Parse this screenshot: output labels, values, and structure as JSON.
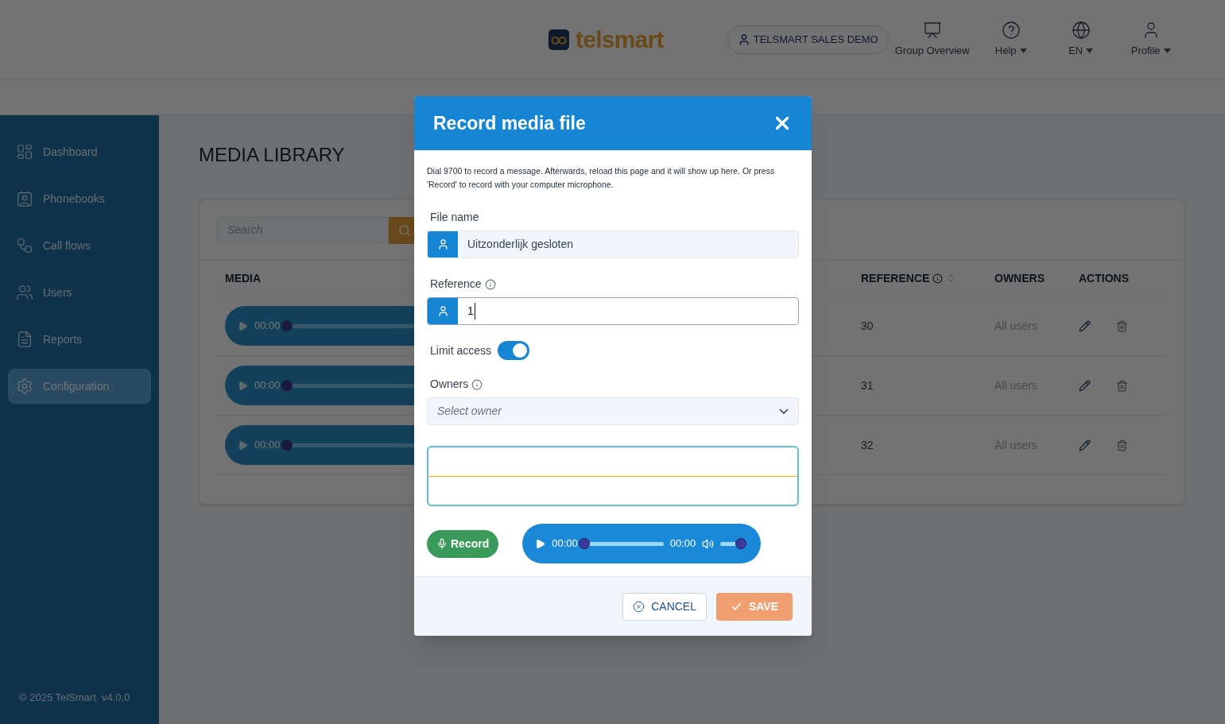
{
  "header": {
    "logo": "telsmart",
    "account": "TELSMART SALES DEMO",
    "nav": [
      {
        "label": "Group Overview",
        "dropdown": false
      },
      {
        "label": "Help",
        "dropdown": true
      },
      {
        "label": "EN",
        "dropdown": true
      },
      {
        "label": "Profile",
        "dropdown": true
      }
    ]
  },
  "sidebar": {
    "items": [
      {
        "label": "Dashboard",
        "selected": false
      },
      {
        "label": "Phonebooks",
        "selected": false
      },
      {
        "label": "Call flows",
        "selected": false
      },
      {
        "label": "Users",
        "selected": false
      },
      {
        "label": "Reports",
        "selected": false
      },
      {
        "label": "Configuration",
        "selected": true
      }
    ],
    "footer": "© 2025 TelSmart  v4.0.0"
  },
  "page": {
    "title": "MEDIA LIBRARY",
    "search": {
      "placeholder": "Search"
    },
    "columns": [
      "MEDIA",
      "REFERENCE",
      "OWNERS",
      "ACTIONS"
    ],
    "rows": [
      {
        "player": {
          "time": "00:00",
          "level": 0
        },
        "reference": "30",
        "owners": "All users"
      },
      {
        "player": {
          "time": "00:00",
          "level": 0
        },
        "reference": "31",
        "owners": "All users"
      },
      {
        "player": {
          "time": "00:00",
          "level": 0
        },
        "reference": "32",
        "owners": "All users"
      }
    ]
  },
  "dialog": {
    "title": "Record media file",
    "intro": "Dial 9700 to record a message. Afterwards, reload this page and it will show up here. Or press 'Record' to record with your computer microphone.",
    "file_name": {
      "label": "File name",
      "value": "Uitzonderlijk gesloten"
    },
    "reference": {
      "label": "Reference",
      "value": "1"
    },
    "limit_access": {
      "label": "Limit access",
      "on": true
    },
    "owners": {
      "label": "Owners",
      "placeholder": "Select owner"
    },
    "record_button": "Record",
    "player": {
      "time": "00:00",
      "duration": "00:00",
      "level": 0,
      "volume": {
        "level": 1
      }
    },
    "buttons": {
      "cancel": "CANCEL",
      "save": "SAVE"
    }
  }
}
